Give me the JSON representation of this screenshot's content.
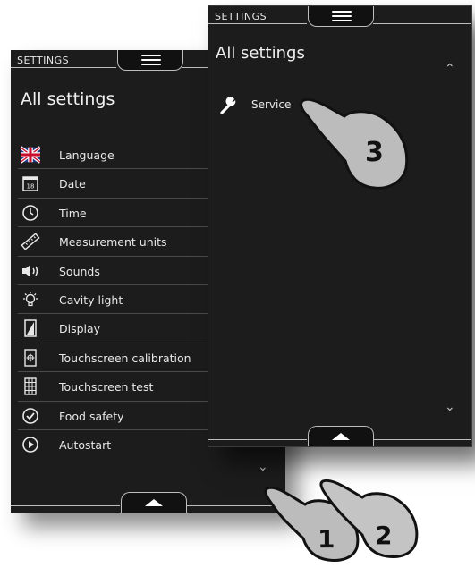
{
  "left_panel": {
    "header_title": "SETTINGS",
    "heading": "All settings",
    "items": [
      {
        "label": "Language",
        "icon": "uk-flag-icon"
      },
      {
        "label": "Date",
        "icon": "calendar-icon",
        "badge": "18"
      },
      {
        "label": "Time",
        "icon": "clock-icon"
      },
      {
        "label": "Measurement units",
        "icon": "ruler-icon"
      },
      {
        "label": "Sounds",
        "icon": "speaker-icon"
      },
      {
        "label": "Cavity light",
        "icon": "light-bulb-icon"
      },
      {
        "label": "Display",
        "icon": "display-icon"
      },
      {
        "label": "Touchscreen calibration",
        "icon": "calibration-icon"
      },
      {
        "label": "Touchscreen test",
        "icon": "grid-icon"
      },
      {
        "label": "Food safety",
        "icon": "check-circle-icon"
      },
      {
        "label": "Autostart",
        "icon": "play-circle-icon"
      }
    ],
    "scroll_down": "⌄"
  },
  "right_panel": {
    "header_title": "SETTINGS",
    "heading": "All settings",
    "item": {
      "label": "Service",
      "icon": "wrench-icon"
    },
    "scroll_up": "⌃",
    "scroll_down": "⌄"
  },
  "annotations": [
    "1",
    "2",
    "3"
  ],
  "colors": {
    "panel": "#1c1c1c",
    "text": "#e8e8e8",
    "divider": "#4a4a4a",
    "hand": "#bcbcbc"
  }
}
